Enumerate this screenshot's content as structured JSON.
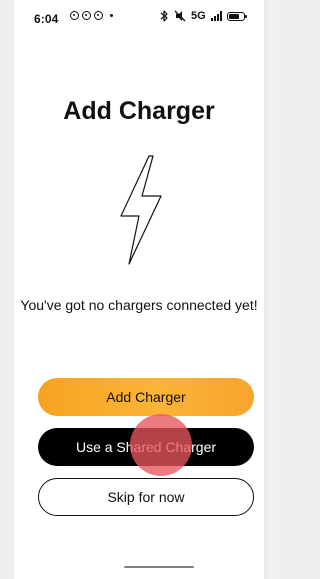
{
  "status_bar": {
    "time": "6:04",
    "network": "5G",
    "icons": [
      "notification-icon",
      "notification-icon",
      "notification-icon",
      "dot-icon",
      "bluetooth-icon",
      "mute-icon",
      "signal-icon",
      "battery-icon"
    ]
  },
  "screen": {
    "title": "Add Charger",
    "icon": "lightning-bolt-icon",
    "message": "You've got no chargers connected yet!"
  },
  "buttons": {
    "primary": "Add Charger",
    "shared": "Use a Shared Charger",
    "skip": "Skip for now"
  },
  "colors": {
    "accent": "#f7aa2b",
    "dark_button": "#000000",
    "touch_indicator": "#e7545e"
  }
}
